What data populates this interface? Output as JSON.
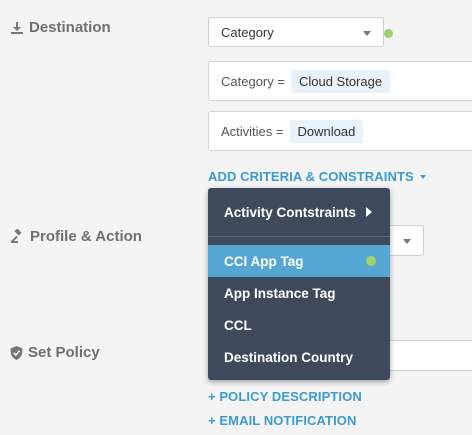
{
  "sections": {
    "destination": {
      "label": "Destination",
      "icon": "download-icon"
    },
    "profile_action": {
      "label": "Profile & Action",
      "icon": "gavel-icon"
    },
    "set_policy": {
      "label": "Set Policy",
      "icon": "shield-icon"
    }
  },
  "destination": {
    "type_select": {
      "value": "Category"
    },
    "filters": [
      {
        "key": "Category =",
        "value": "Cloud Storage"
      },
      {
        "key": "Activities =",
        "value": "Download"
      }
    ],
    "add_criteria_link": "ADD CRITERIA & CONSTRAINTS"
  },
  "criteria_menu": {
    "items": [
      {
        "label": "Activity Contstraints",
        "has_submenu": true
      },
      {
        "label": "CCI App Tag",
        "selected": true
      },
      {
        "label": "App Instance Tag"
      },
      {
        "label": "CCL"
      },
      {
        "label": "Destination Country"
      }
    ]
  },
  "links": {
    "policy_description": "+ POLICY DESCRIPTION",
    "email_notification": "+ EMAIL NOTIFICATION"
  },
  "colors": {
    "background": "#f4f4f4",
    "link": "#3a9ad1",
    "menu_bg": "#3e4a5b",
    "menu_selected": "#56a6d4",
    "indicator_dot": "#9dd36f",
    "chip_bg": "#e8f2fa"
  }
}
